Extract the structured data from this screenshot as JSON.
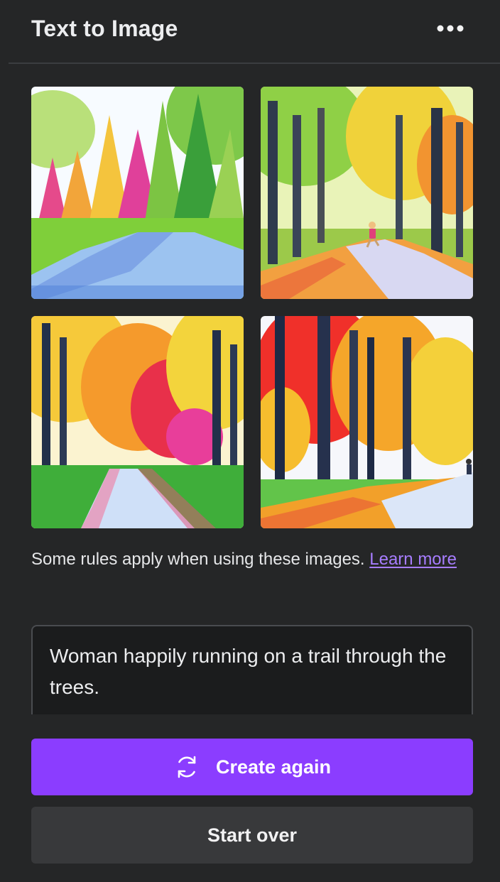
{
  "header": {
    "title": "Text to Image",
    "menu_icon": "more-horizontal-icon"
  },
  "results": [
    {
      "description": "watercolor autumn park path"
    },
    {
      "description": "watercolor forest trail with runner"
    },
    {
      "description": "watercolor autumn trees over path"
    },
    {
      "description": "watercolor red autumn forest trail"
    }
  ],
  "notice": {
    "text": "Some rules apply when using these images.",
    "link_label": "Learn more"
  },
  "prompt": {
    "value": "Woman happily running on a trail through the trees."
  },
  "actions": {
    "create_again_label": "Create again",
    "create_again_icon": "refresh-icon",
    "start_over_label": "Start over"
  },
  "colors": {
    "background": "#252627",
    "accent": "#8b3dff",
    "link": "#a77dff",
    "secondary_button": "#38393b"
  }
}
